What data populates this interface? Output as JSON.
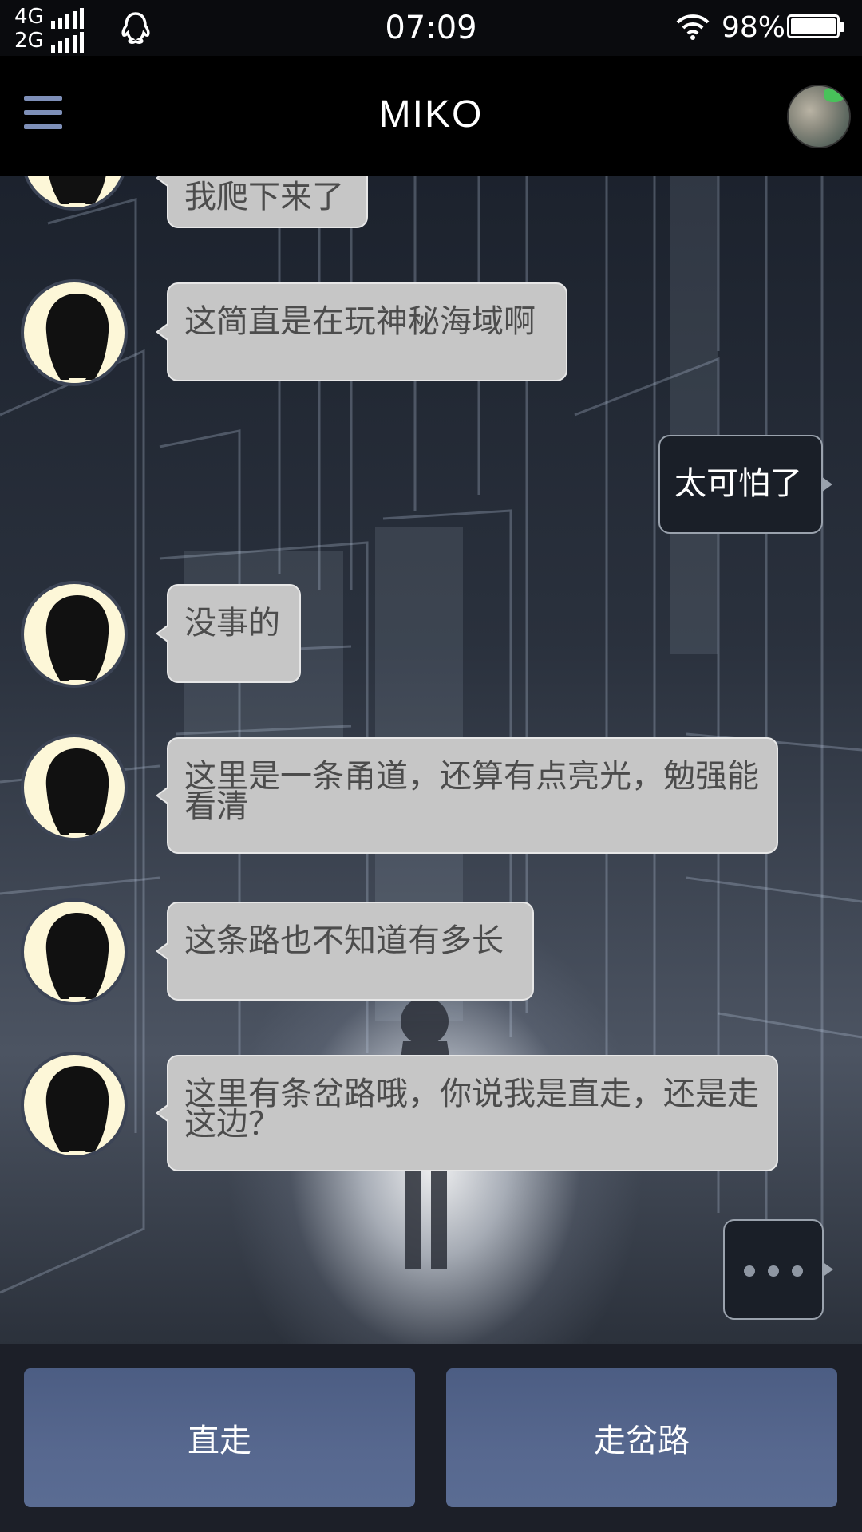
{
  "status_bar": {
    "network_top": "4G",
    "network_bottom": "2G",
    "time": "07:09",
    "battery": "98%",
    "icons": [
      "signal-icon",
      "qq-penguin-icon",
      "wifi-icon",
      "battery-icon"
    ]
  },
  "header": {
    "title": "MIKO",
    "icons": [
      "hamburger-menu-icon",
      "profile-avatar"
    ]
  },
  "messages": [
    {
      "sender": "bot",
      "text": "我爬下来了"
    },
    {
      "sender": "bot",
      "text": "这简直是在玩神秘海域啊"
    },
    {
      "sender": "user",
      "text": "太可怕了"
    },
    {
      "sender": "bot",
      "text": "没事的"
    },
    {
      "sender": "bot",
      "text": "这里是一条甬道，还算有点亮光，勉强能看清"
    },
    {
      "sender": "bot",
      "text": "这条路也不知道有多长"
    },
    {
      "sender": "bot",
      "text": "这里有条岔路哦，你说我是直走，还是走这边？"
    },
    {
      "sender": "user",
      "type": "typing"
    }
  ],
  "choices": [
    {
      "label": "直走"
    },
    {
      "label": "走岔路"
    }
  ],
  "colors": {
    "bot_bubble": "#c6c6c6",
    "user_bubble": "#1a1f28",
    "choice_button": "#55668d",
    "menu_icon": "#7e8fb8"
  }
}
